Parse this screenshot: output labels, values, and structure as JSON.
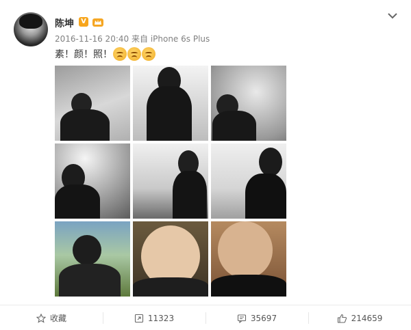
{
  "post": {
    "username": "陈坤",
    "verified_badge": "V",
    "timestamp": "2016-11-16 20:40",
    "source_prefix": "来自",
    "source_device": "iPhone 6s Plus",
    "text": "素！颜！照！",
    "emojis": [
      "weary-face-emoji",
      "weary-face-emoji",
      "weary-face-emoji"
    ],
    "photos": [
      {
        "name": "photo-1"
      },
      {
        "name": "photo-2"
      },
      {
        "name": "photo-3"
      },
      {
        "name": "photo-4"
      },
      {
        "name": "photo-5"
      },
      {
        "name": "photo-6"
      },
      {
        "name": "photo-7"
      },
      {
        "name": "photo-8"
      },
      {
        "name": "photo-9"
      }
    ]
  },
  "actions": {
    "favorite_label": "收藏",
    "repost_count": "11323",
    "comment_count": "35697",
    "like_count": "214659"
  },
  "colors": {
    "verified_orange": "#f7a51c",
    "meta_gray": "#808080",
    "text_dark": "#333333"
  }
}
